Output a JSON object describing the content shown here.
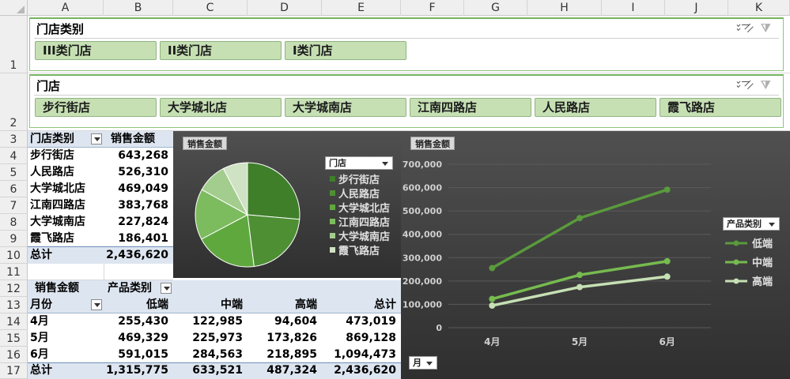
{
  "columns": [
    "A",
    "B",
    "C",
    "D",
    "E",
    "F",
    "G",
    "H",
    "I",
    "J",
    "K"
  ],
  "rows": [
    "1",
    "2",
    "3",
    "4",
    "5",
    "6",
    "7",
    "8",
    "9",
    "10",
    "11",
    "12",
    "13",
    "14",
    "15",
    "16",
    "17"
  ],
  "slicer_category": {
    "title": "门店类别",
    "items": [
      "III类门店",
      "II类门店",
      "I类门店"
    ]
  },
  "slicer_store": {
    "title": "门店",
    "items": [
      "步行街店",
      "大学城北店",
      "大学城南店",
      "江南四路店",
      "人民路店",
      "霞飞路店"
    ]
  },
  "pivot1": {
    "header_row_label": "门店类别",
    "header_value": "销售金额",
    "rows": [
      {
        "label": "步行街店",
        "value": "643,268"
      },
      {
        "label": "人民路店",
        "value": "526,310"
      },
      {
        "label": "大学城北店",
        "value": "469,049"
      },
      {
        "label": "江南四路店",
        "value": "383,768"
      },
      {
        "label": "大学城南店",
        "value": "227,824"
      },
      {
        "label": "霞飞路店",
        "value": "186,401"
      }
    ],
    "total_label": "总计",
    "total_value": "2,436,620"
  },
  "pivot2": {
    "values_label": "销售金额",
    "column_field": "产品类别",
    "row_field": "月份",
    "col_headers": [
      "低端",
      "中端",
      "高端",
      "总计"
    ],
    "rows": [
      {
        "label": "4月",
        "values": [
          "255,430",
          "122,985",
          "94,604",
          "473,019"
        ]
      },
      {
        "label": "5月",
        "values": [
          "469,329",
          "225,973",
          "173,826",
          "869,128"
        ]
      },
      {
        "label": "6月",
        "values": [
          "591,015",
          "284,563",
          "218,895",
          "1,094,473"
        ]
      }
    ],
    "total_label": "总计",
    "total_values": [
      "1,315,775",
      "633,521",
      "487,324",
      "2,436,620"
    ]
  },
  "pie_chart": {
    "field_button": "销售金额",
    "legend_title": "门店",
    "colors": [
      "#3f7f2a",
      "#4e8f34",
      "#5fa83e",
      "#7cbb5e",
      "#a3cd8e",
      "#cfe2c4"
    ]
  },
  "line_chart": {
    "field_button": "销售金额",
    "legend_title": "产品类别",
    "axis_button": "月",
    "colors": [
      "#5a9a3c",
      "#76bb4f",
      "#c6e0b4"
    ]
  },
  "chart_data": [
    {
      "type": "pie",
      "categories": [
        "步行街店",
        "人民路店",
        "大学城北店",
        "江南四路店",
        "大学城南店",
        "霞飞路店"
      ],
      "values": [
        643268,
        526310,
        469049,
        383768,
        227824,
        186401
      ]
    },
    {
      "type": "line",
      "categories": [
        "4月",
        "5月",
        "6月"
      ],
      "series": [
        {
          "name": "低端",
          "values": [
            255430,
            469329,
            591015
          ]
        },
        {
          "name": "中端",
          "values": [
            122985,
            225973,
            284563
          ]
        },
        {
          "name": "高端",
          "values": [
            94604,
            173826,
            218895
          ]
        }
      ],
      "ylim": [
        0,
        700000
      ],
      "yticks": [
        "0",
        "100,000",
        "200,000",
        "300,000",
        "400,000",
        "500,000",
        "600,000",
        "700,000"
      ],
      "grid": true,
      "legend": "right"
    }
  ]
}
